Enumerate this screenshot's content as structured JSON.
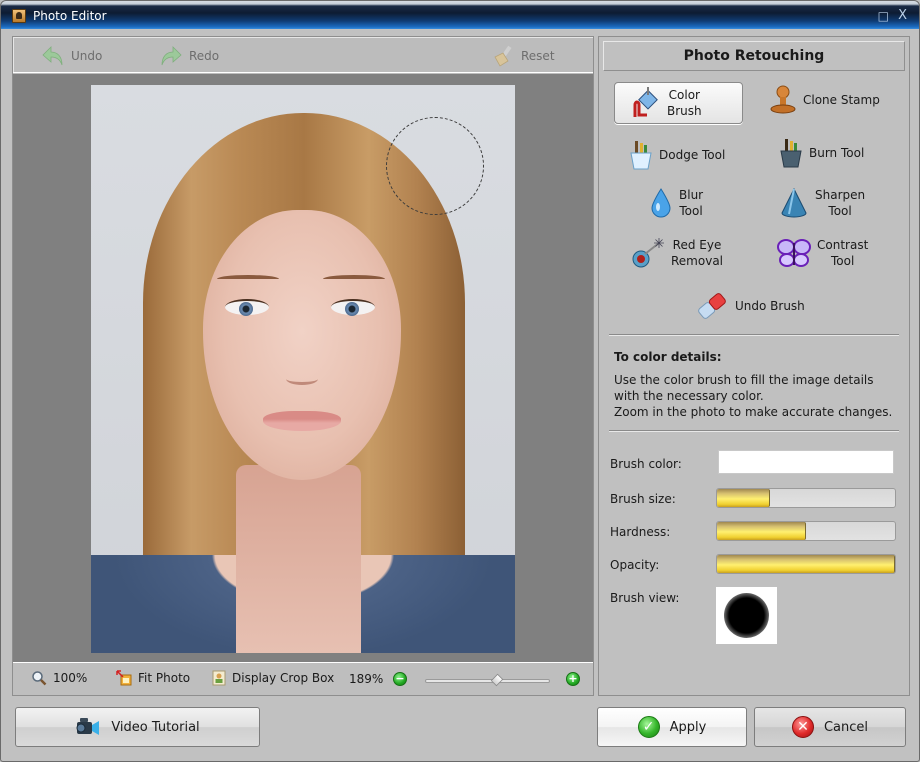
{
  "window": {
    "title": "Photo Editor",
    "maximize_glyph": "□",
    "close_glyph": "X"
  },
  "toolbar": {
    "undo_label": "Undo",
    "redo_label": "Redo",
    "reset_label": "Reset"
  },
  "zoom_bar": {
    "actual_size_label": "100%",
    "fit_photo_label": "Fit Photo",
    "crop_box_label": "Display Crop Box",
    "zoom_percent": "189%",
    "zoom_out_glyph": "−",
    "zoom_in_glyph": "+",
    "zoom_slider_fraction": 0.58
  },
  "retouch": {
    "title": "Photo Retouching",
    "tools": [
      {
        "id": "color-brush",
        "line1": "Color",
        "line2": "Brush",
        "selected": true
      },
      {
        "id": "clone-stamp",
        "line1": "Clone Stamp",
        "line2": ""
      },
      {
        "id": "dodge-tool",
        "line1": "Dodge Tool",
        "line2": ""
      },
      {
        "id": "burn-tool",
        "line1": "Burn Tool",
        "line2": ""
      },
      {
        "id": "blur-tool",
        "line1": "Blur",
        "line2": "Tool"
      },
      {
        "id": "sharpen-tool",
        "line1": "Sharpen",
        "line2": "Tool"
      },
      {
        "id": "red-eye-removal",
        "line1": "Red Eye",
        "line2": "Removal"
      },
      {
        "id": "contrast-tool",
        "line1": "Contrast",
        "line2": "Tool"
      },
      {
        "id": "undo-brush",
        "line1": "Undo Brush",
        "line2": ""
      }
    ],
    "info_title": "To color details:",
    "info_lines": [
      "Use the color brush to fill the image details",
      "with the necessary color.",
      "Zoom in the photo to make accurate changes."
    ],
    "properties": {
      "brush_color_label": "Brush color:",
      "brush_color_value": "#ffffff",
      "brush_size_label": "Brush size:",
      "brush_size_fraction": 0.3,
      "hardness_label": "Hardness:",
      "hardness_fraction": 0.5,
      "opacity_label": "Opacity:",
      "opacity_fraction": 1.0,
      "brush_view_label": "Brush view:"
    }
  },
  "buttons": {
    "video_tutorial": "Video Tutorial",
    "apply": "Apply",
    "cancel": "Cancel"
  }
}
